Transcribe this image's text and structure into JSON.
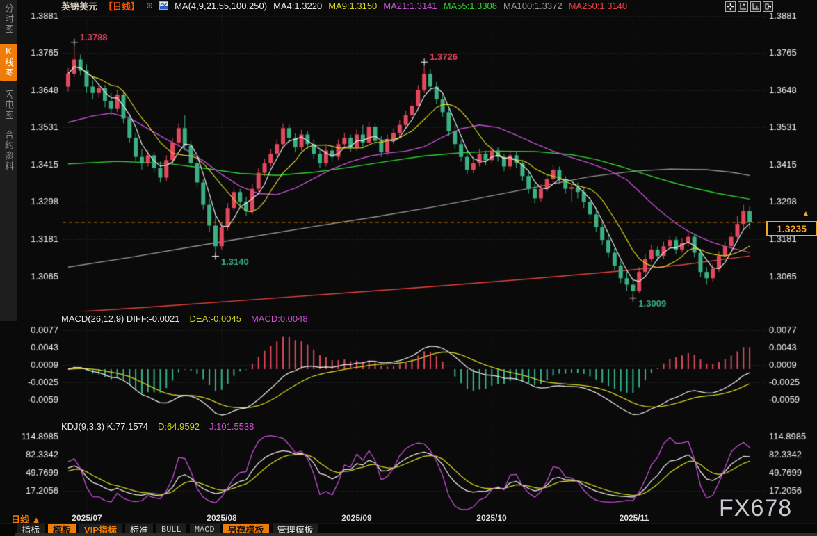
{
  "colors": {
    "accent_orange": "#ef7c08",
    "up_red": "#e3495c",
    "down_green": "#3bb183",
    "tag_orange": "#ffa42a",
    "ma_white": "#e8e8e8",
    "ma_yellow": "#d4d41e",
    "ma_magenta": "#c44fd6",
    "ma_green": "#2ed22e",
    "ma_gray": "#969696",
    "ma_red": "#e8423e",
    "grid": "#3a3a3a",
    "axis_text": "#f2f2f2"
  },
  "sidebar": {
    "items": [
      {
        "label": "分时图",
        "active": false
      },
      {
        "label": "K线图",
        "active": true
      },
      {
        "label": "闪电图",
        "active": false
      },
      {
        "label": "合约资料",
        "active": false
      }
    ]
  },
  "header": {
    "symbol": "英镑美元",
    "period_tag": "【日线】",
    "settings_glyph": "⊕",
    "ma_group_label": "MA(4,9,21,55,100,250)",
    "ma_values": [
      {
        "label": "MA4:1.3220",
        "color": "#e8e8e8"
      },
      {
        "label": "MA9:1.3150",
        "color": "#d4d41e"
      },
      {
        "label": "MA21:1.3141",
        "color": "#c44fd6"
      },
      {
        "label": "MA55:1.3308",
        "color": "#2ed22e"
      },
      {
        "label": "MA100:1.3372",
        "color": "#969696"
      },
      {
        "label": "MA250:1.3140",
        "color": "#e8423e"
      }
    ],
    "window_icons": [
      "crosshair-icon",
      "axis-expand-left-icon",
      "axis-expand-right-icon",
      "detach-window-icon"
    ]
  },
  "price_tag": {
    "value": "1.3235",
    "arrow": "▲"
  },
  "watermark": "FX678",
  "bottom": {
    "timeframe": "日线 ▲",
    "tabs": [
      {
        "label": "指标",
        "style": "plain"
      },
      {
        "label": "模板",
        "style": "orange-bg"
      },
      {
        "label": "VIP指标",
        "style": "orange-text"
      },
      {
        "label": "标准",
        "style": "plain"
      },
      {
        "label": "BULL",
        "style": "mono"
      },
      {
        "label": "MACD",
        "style": "mono"
      },
      {
        "label": "另存模板",
        "style": "orange-bg"
      },
      {
        "label": "管理模板",
        "style": "plain"
      }
    ]
  },
  "chart_data": {
    "type": "candlestick",
    "title": "英镑美元 日线 (GBP/USD Daily)",
    "price_axis": {
      "labels": [
        "1.3881",
        "1.3765",
        "1.3648",
        "1.3531",
        "1.3415",
        "1.3298",
        "1.3181",
        "1.3065"
      ],
      "top_value": 1.3881,
      "bottom_value": 1.3065
    },
    "x_axis": {
      "labels": [
        "2025/07",
        "2025/08",
        "2025/09",
        "2025/10",
        "2025/11"
      ],
      "tick_indices": [
        3,
        25,
        47,
        69,
        92
      ]
    },
    "last_price": 1.3235,
    "annotations": [
      {
        "text": "1.3788",
        "index": 1,
        "type": "high",
        "color": "#e8485c"
      },
      {
        "text": "1.3726",
        "index": 58,
        "type": "high",
        "color": "#e8485c"
      },
      {
        "text": "1.3140",
        "index": 24,
        "type": "low",
        "color": "#3bb183"
      },
      {
        "text": "1.3009",
        "index": 92,
        "type": "low",
        "color": "#3bb183"
      }
    ],
    "candles": [
      [
        1.366,
        1.3718,
        1.3645,
        1.37
      ],
      [
        1.37,
        1.3788,
        1.369,
        1.3745
      ],
      [
        1.3745,
        1.376,
        1.3695,
        1.371
      ],
      [
        1.371,
        1.373,
        1.364,
        1.366
      ],
      [
        1.366,
        1.368,
        1.362,
        1.364
      ],
      [
        1.364,
        1.367,
        1.3625,
        1.3655
      ],
      [
        1.3655,
        1.3665,
        1.3595,
        1.3615
      ],
      [
        1.3615,
        1.364,
        1.357,
        1.359
      ],
      [
        1.359,
        1.365,
        1.358,
        1.3635
      ],
      [
        1.3635,
        1.3645,
        1.3545,
        1.356
      ],
      [
        1.356,
        1.3575,
        1.3485,
        1.35
      ],
      [
        1.35,
        1.3515,
        1.3425,
        1.344
      ],
      [
        1.344,
        1.3465,
        1.34,
        1.342
      ],
      [
        1.342,
        1.346,
        1.341,
        1.3445
      ],
      [
        1.3445,
        1.3455,
        1.339,
        1.3405
      ],
      [
        1.3405,
        1.3425,
        1.336,
        1.3375
      ],
      [
        1.3375,
        1.3445,
        1.3365,
        1.343
      ],
      [
        1.343,
        1.35,
        1.342,
        1.3485
      ],
      [
        1.3485,
        1.3545,
        1.3475,
        1.353
      ],
      [
        1.353,
        1.357,
        1.346,
        1.3475
      ],
      [
        1.3475,
        1.349,
        1.3405,
        1.342
      ],
      [
        1.342,
        1.344,
        1.3345,
        1.336
      ],
      [
        1.336,
        1.337,
        1.3275,
        1.329
      ],
      [
        1.329,
        1.331,
        1.3205,
        1.3225
      ],
      [
        1.3225,
        1.326,
        1.314,
        1.316
      ],
      [
        1.316,
        1.3235,
        1.315,
        1.322
      ],
      [
        1.322,
        1.3295,
        1.321,
        1.328
      ],
      [
        1.328,
        1.3345,
        1.327,
        1.333
      ],
      [
        1.333,
        1.334,
        1.3285,
        1.33
      ],
      [
        1.33,
        1.3315,
        1.3255,
        1.327
      ],
      [
        1.327,
        1.3355,
        1.326,
        1.334
      ],
      [
        1.334,
        1.3405,
        1.333,
        1.339
      ],
      [
        1.339,
        1.3435,
        1.338,
        1.342
      ],
      [
        1.342,
        1.3465,
        1.341,
        1.345
      ],
      [
        1.345,
        1.3495,
        1.344,
        1.348
      ],
      [
        1.348,
        1.3545,
        1.347,
        1.353
      ],
      [
        1.353,
        1.354,
        1.3485,
        1.35
      ],
      [
        1.35,
        1.3515,
        1.3455,
        1.347
      ],
      [
        1.347,
        1.3525,
        1.346,
        1.351
      ],
      [
        1.351,
        1.352,
        1.3465,
        1.348
      ],
      [
        1.348,
        1.3495,
        1.3435,
        1.345
      ],
      [
        1.345,
        1.3465,
        1.3405,
        1.342
      ],
      [
        1.342,
        1.3475,
        1.341,
        1.346
      ],
      [
        1.346,
        1.347,
        1.3425,
        1.344
      ],
      [
        1.344,
        1.3495,
        1.343,
        1.348
      ],
      [
        1.348,
        1.3515,
        1.347,
        1.35
      ],
      [
        1.35,
        1.351,
        1.3455,
        1.347
      ],
      [
        1.347,
        1.3525,
        1.346,
        1.351
      ],
      [
        1.351,
        1.354,
        1.347,
        1.3485
      ],
      [
        1.3485,
        1.355,
        1.348,
        1.3535
      ],
      [
        1.3535,
        1.3545,
        1.3475,
        1.349
      ],
      [
        1.349,
        1.3505,
        1.344,
        1.3455
      ],
      [
        1.3455,
        1.351,
        1.3445,
        1.3495
      ],
      [
        1.3495,
        1.353,
        1.348,
        1.3515
      ],
      [
        1.3515,
        1.3555,
        1.35,
        1.354
      ],
      [
        1.354,
        1.3585,
        1.353,
        1.357
      ],
      [
        1.357,
        1.3615,
        1.356,
        1.36
      ],
      [
        1.36,
        1.3665,
        1.359,
        1.365
      ],
      [
        1.365,
        1.3726,
        1.364,
        1.37
      ],
      [
        1.37,
        1.3715,
        1.3645,
        1.366
      ],
      [
        1.366,
        1.3675,
        1.3605,
        1.362
      ],
      [
        1.362,
        1.3635,
        1.3565,
        1.358
      ],
      [
        1.358,
        1.359,
        1.3505,
        1.352
      ],
      [
        1.352,
        1.354,
        1.3465,
        1.348
      ],
      [
        1.348,
        1.3495,
        1.3425,
        1.344
      ],
      [
        1.344,
        1.3455,
        1.3385,
        1.34
      ],
      [
        1.34,
        1.3435,
        1.339,
        1.342
      ],
      [
        1.342,
        1.3465,
        1.341,
        1.345
      ],
      [
        1.345,
        1.346,
        1.3415,
        1.343
      ],
      [
        1.343,
        1.3475,
        1.342,
        1.346
      ],
      [
        1.346,
        1.347,
        1.3425,
        1.344
      ],
      [
        1.344,
        1.345,
        1.3395,
        1.341
      ],
      [
        1.341,
        1.346,
        1.34,
        1.3445
      ],
      [
        1.3445,
        1.3455,
        1.3405,
        1.342
      ],
      [
        1.342,
        1.343,
        1.3365,
        1.338
      ],
      [
        1.338,
        1.3395,
        1.3325,
        1.334
      ],
      [
        1.334,
        1.3355,
        1.3295,
        1.331
      ],
      [
        1.331,
        1.3355,
        1.33,
        1.334
      ],
      [
        1.334,
        1.3385,
        1.333,
        1.337
      ],
      [
        1.337,
        1.3415,
        1.336,
        1.34
      ],
      [
        1.34,
        1.341,
        1.3355,
        1.337
      ],
      [
        1.337,
        1.338,
        1.3325,
        1.334
      ],
      [
        1.334,
        1.3355,
        1.33,
        1.3345
      ],
      [
        1.3345,
        1.336,
        1.331,
        1.333
      ],
      [
        1.333,
        1.3345,
        1.328,
        1.33
      ],
      [
        1.33,
        1.3315,
        1.3245,
        1.326
      ],
      [
        1.326,
        1.3275,
        1.3205,
        1.322
      ],
      [
        1.322,
        1.3235,
        1.3165,
        1.318
      ],
      [
        1.318,
        1.3195,
        1.3125,
        1.314
      ],
      [
        1.314,
        1.3155,
        1.3085,
        1.31
      ],
      [
        1.31,
        1.3115,
        1.3045,
        1.306
      ],
      [
        1.306,
        1.308,
        1.302,
        1.304
      ],
      [
        1.304,
        1.306,
        1.3009,
        1.302
      ],
      [
        1.302,
        1.3095,
        1.3015,
        1.308
      ],
      [
        1.308,
        1.3135,
        1.307,
        1.312
      ],
      [
        1.312,
        1.3165,
        1.311,
        1.315
      ],
      [
        1.315,
        1.316,
        1.3115,
        1.313
      ],
      [
        1.313,
        1.3175,
        1.312,
        1.316
      ],
      [
        1.316,
        1.3195,
        1.315,
        1.318
      ],
      [
        1.318,
        1.319,
        1.3135,
        1.315
      ],
      [
        1.315,
        1.3185,
        1.314,
        1.317
      ],
      [
        1.317,
        1.3205,
        1.316,
        1.319
      ],
      [
        1.319,
        1.32,
        1.3125,
        1.314
      ],
      [
        1.314,
        1.315,
        1.3065,
        1.308
      ],
      [
        1.308,
        1.3095,
        1.304,
        1.306
      ],
      [
        1.306,
        1.3105,
        1.305,
        1.309
      ],
      [
        1.309,
        1.3145,
        1.308,
        1.313
      ],
      [
        1.313,
        1.3175,
        1.312,
        1.316
      ],
      [
        1.316,
        1.3205,
        1.315,
        1.319
      ],
      [
        1.319,
        1.3255,
        1.318,
        1.323
      ],
      [
        1.323,
        1.329,
        1.321,
        1.327
      ],
      [
        1.327,
        1.3285,
        1.3215,
        1.3235
      ]
    ],
    "fast_ma": [
      {
        "period": 4,
        "color": "#e8e8e8"
      },
      {
        "period": 9,
        "color": "#d4d41e"
      }
    ],
    "overlay_ma": [
      {
        "name": "MA21",
        "color": "#c44fd6",
        "points": [
          [
            0,
            1.3548
          ],
          [
            4,
            1.3568
          ],
          [
            7,
            1.3577
          ],
          [
            10,
            1.3562
          ],
          [
            13,
            1.3528
          ],
          [
            16,
            1.3495
          ],
          [
            19,
            1.3465
          ],
          [
            22,
            1.3428
          ],
          [
            25,
            1.3385
          ],
          [
            28,
            1.3348
          ],
          [
            31,
            1.3325
          ],
          [
            34,
            1.3322
          ],
          [
            37,
            1.3342
          ],
          [
            40,
            1.3372
          ],
          [
            43,
            1.3402
          ],
          [
            46,
            1.3425
          ],
          [
            49,
            1.3442
          ],
          [
            52,
            1.3452
          ],
          [
            55,
            1.3458
          ],
          [
            58,
            1.3472
          ],
          [
            61,
            1.3502
          ],
          [
            64,
            1.3528
          ],
          [
            67,
            1.354
          ],
          [
            70,
            1.3532
          ],
          [
            73,
            1.3508
          ],
          [
            76,
            1.3482
          ],
          [
            79,
            1.3458
          ],
          [
            82,
            1.3438
          ],
          [
            85,
            1.342
          ],
          [
            88,
            1.3398
          ],
          [
            91,
            1.3368
          ],
          [
            93,
            1.3332
          ],
          [
            95,
            1.3295
          ],
          [
            97,
            1.3262
          ],
          [
            99,
            1.3232
          ],
          [
            101,
            1.3208
          ],
          [
            103,
            1.3188
          ],
          [
            105,
            1.3172
          ],
          [
            107,
            1.316
          ],
          [
            109,
            1.315
          ],
          [
            111,
            1.3141
          ]
        ]
      },
      {
        "name": "MA55",
        "color": "#2ed22e",
        "points": [
          [
            0,
            1.3418
          ],
          [
            8,
            1.3426
          ],
          [
            16,
            1.342
          ],
          [
            22,
            1.3405
          ],
          [
            28,
            1.3388
          ],
          [
            34,
            1.3382
          ],
          [
            40,
            1.3392
          ],
          [
            46,
            1.3408
          ],
          [
            52,
            1.3426
          ],
          [
            58,
            1.3443
          ],
          [
            64,
            1.3453
          ],
          [
            70,
            1.3458
          ],
          [
            76,
            1.3457
          ],
          [
            82,
            1.3447
          ],
          [
            86,
            1.3432
          ],
          [
            90,
            1.341
          ],
          [
            94,
            1.3385
          ],
          [
            98,
            1.3362
          ],
          [
            102,
            1.3342
          ],
          [
            106,
            1.3325
          ],
          [
            111,
            1.3308
          ]
        ]
      },
      {
        "name": "MA100",
        "color": "#969696",
        "points": [
          [
            0,
            1.3095
          ],
          [
            10,
            1.3125
          ],
          [
            20,
            1.3158
          ],
          [
            30,
            1.319
          ],
          [
            40,
            1.3222
          ],
          [
            50,
            1.3252
          ],
          [
            60,
            1.3285
          ],
          [
            70,
            1.3322
          ],
          [
            78,
            1.3352
          ],
          [
            85,
            1.3378
          ],
          [
            92,
            1.3395
          ],
          [
            98,
            1.3402
          ],
          [
            104,
            1.34
          ],
          [
            108,
            1.3392
          ],
          [
            111,
            1.3382
          ]
        ]
      },
      {
        "name": "MA250",
        "color": "#e8423e",
        "points": [
          [
            0,
            1.2953
          ],
          [
            15,
            1.2972
          ],
          [
            30,
            1.2993
          ],
          [
            45,
            1.3014
          ],
          [
            60,
            1.3035
          ],
          [
            75,
            1.3058
          ],
          [
            90,
            1.3083
          ],
          [
            100,
            1.3102
          ],
          [
            111,
            1.313
          ]
        ]
      }
    ],
    "macd": {
      "params": [
        26,
        12,
        9
      ],
      "header_segments": [
        {
          "text": "MACD(26,12,9) DIFF:-0.0021",
          "color": "#e8e8e8"
        },
        {
          "text": "DEA:-0.0045",
          "color": "#d4d41e"
        },
        {
          "text": "MACD:0.0048",
          "color": "#d24fd6"
        }
      ],
      "axis_labels": [
        "0.0077",
        "0.0043",
        "0.0009",
        "-0.0025",
        "-0.0059"
      ]
    },
    "kdj": {
      "params": [
        9,
        3,
        3
      ],
      "header_segments": [
        {
          "text": "KDJ(9,3,3) K:77.1574",
          "color": "#e8e8e8"
        },
        {
          "text": "D:64.9592",
          "color": "#d4d41e"
        },
        {
          "text": "J:101.5538",
          "color": "#d24fd6"
        }
      ],
      "axis_labels": [
        "114.8985",
        "82.3342",
        "49.7699",
        "17.2056"
      ]
    }
  }
}
